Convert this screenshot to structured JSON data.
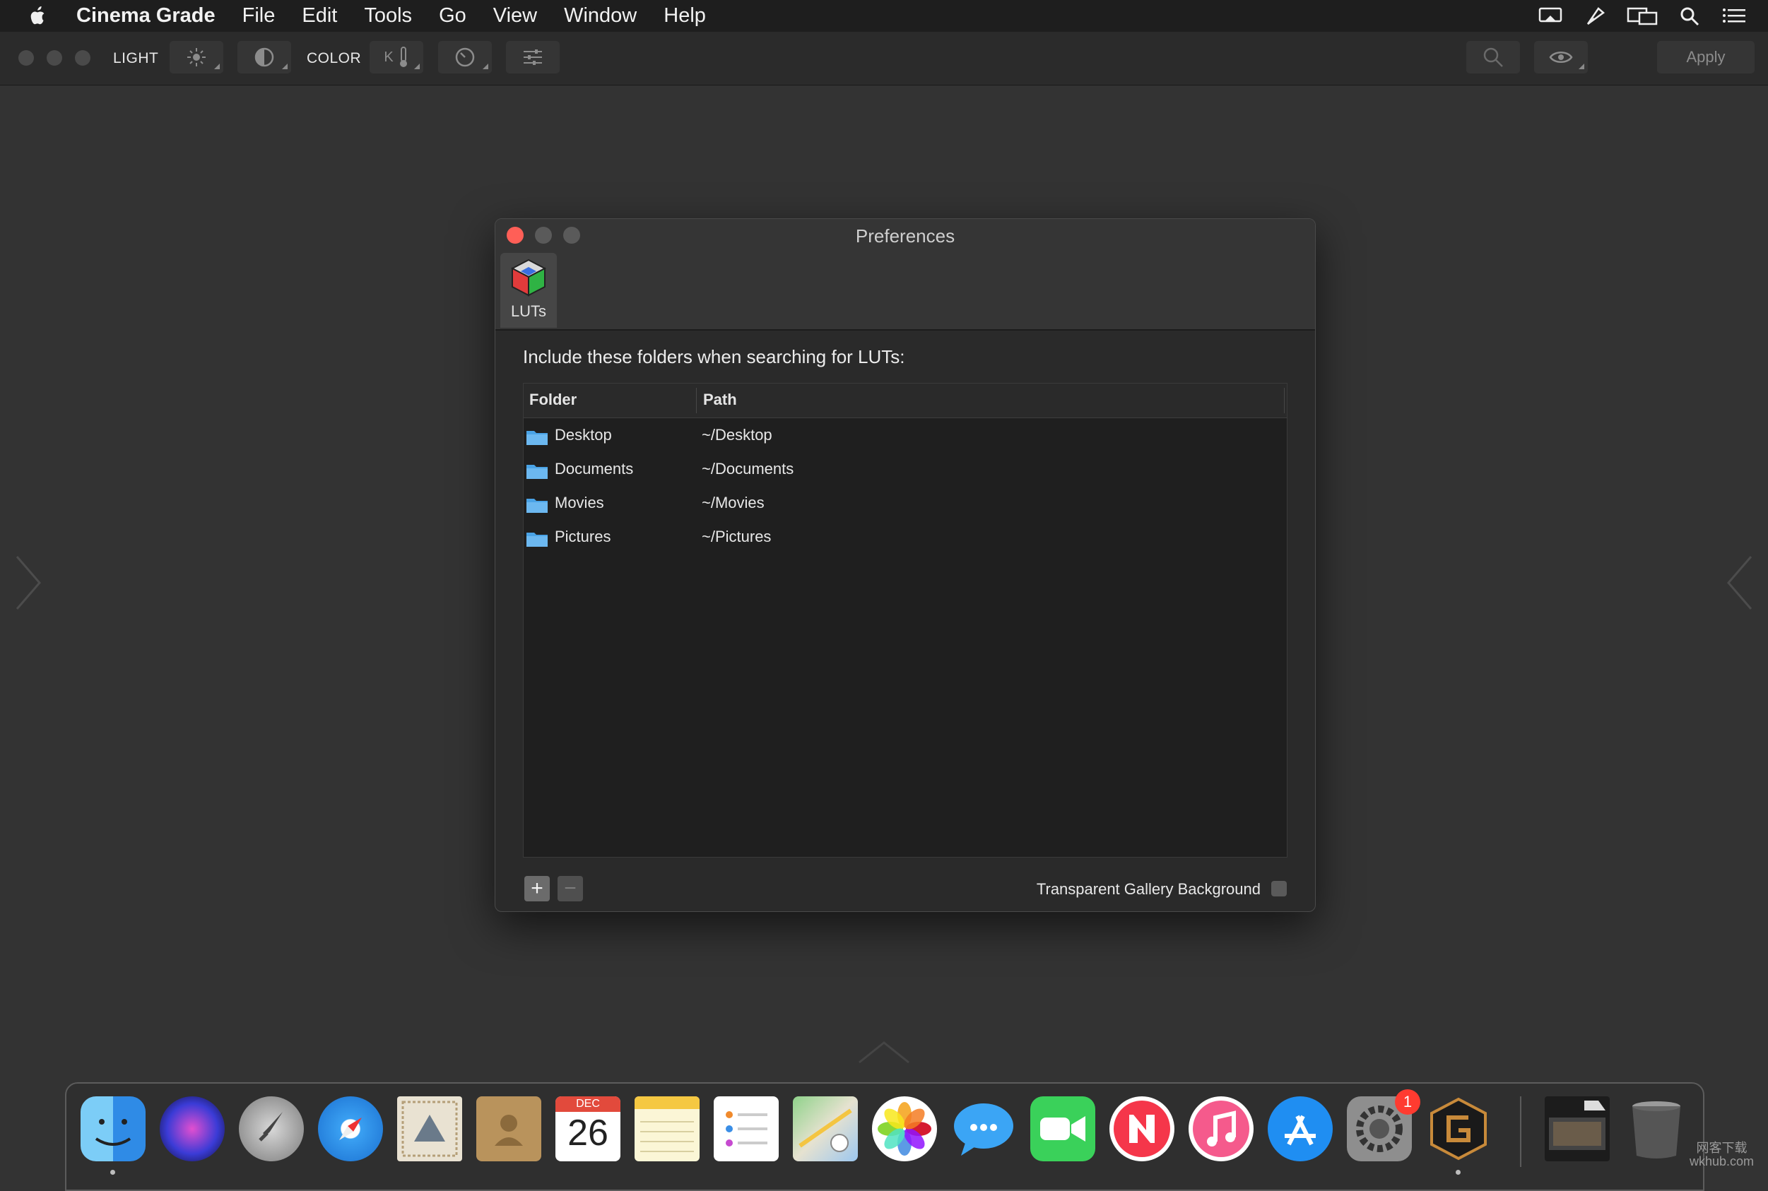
{
  "menubar": {
    "app_name": "Cinema Grade",
    "items": [
      "File",
      "Edit",
      "Tools",
      "Go",
      "View",
      "Window",
      "Help"
    ],
    "status_icons": [
      "notifications-icon",
      "airplay-icon",
      "display-mirroring-icon",
      "spotlight-search-icon",
      "notification-center-icon"
    ]
  },
  "toolbar": {
    "light_label": "LIGHT",
    "color_label": "COLOR",
    "apply_label": "Apply",
    "k_label": "K"
  },
  "prefs": {
    "title": "Preferences",
    "tab_label": "LUTs",
    "prompt": "Include these folders when searching for LUTs:",
    "columns": [
      "Folder",
      "Path"
    ],
    "rows": [
      {
        "folder": "Desktop",
        "path": "~/Desktop"
      },
      {
        "folder": "Documents",
        "path": "~/Documents"
      },
      {
        "folder": "Movies",
        "path": "~/Movies"
      },
      {
        "folder": "Pictures",
        "path": "~/Pictures"
      }
    ],
    "add_label": "+",
    "remove_label": "−",
    "transparent_label": "Transparent Gallery Background",
    "transparent_checked": false
  },
  "dock": {
    "calendar_month": "DEC",
    "calendar_day": "26",
    "badge_count": "1",
    "apps": [
      "finder-icon",
      "siri-icon",
      "launchpad-icon",
      "safari-icon",
      "mail-icon",
      "contacts-icon",
      "calendar-icon",
      "notes-icon",
      "reminders-icon",
      "maps-icon",
      "photos-icon",
      "messages-icon",
      "facetime-icon",
      "news-icon",
      "music-icon",
      "app-store-icon",
      "system-preferences-icon",
      "cinema-grade-icon",
      "downloads-stack-icon",
      "trash-icon"
    ]
  },
  "watermark": {
    "line1": "网客下载",
    "line2": "wkhub.com"
  },
  "colors": {
    "accent_folder": "#4aa3e6",
    "close": "#ff5f57",
    "badge": "#ff3b30"
  }
}
